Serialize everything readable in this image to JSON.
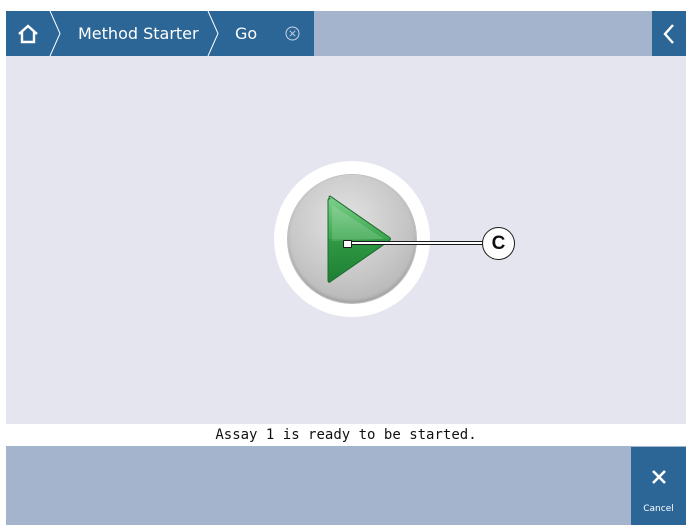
{
  "breadcrumb": {
    "home_icon": "home-icon",
    "items": [
      {
        "label": "Method Starter"
      },
      {
        "label": "Go"
      }
    ],
    "close_icon": "circle-x-icon"
  },
  "header": {
    "back_icon": "chevron-left-icon"
  },
  "main": {
    "play_icon": "play-icon",
    "callout_label": "C"
  },
  "status": {
    "message": "Assay 1 is ready to be started."
  },
  "footer": {
    "cancel_label": "Cancel",
    "cancel_icon": "x-icon"
  },
  "colors": {
    "accent": "#2c6696",
    "bar": "#a3b4cc",
    "background": "#e4e5ee",
    "play_green": "#3aa64e"
  }
}
